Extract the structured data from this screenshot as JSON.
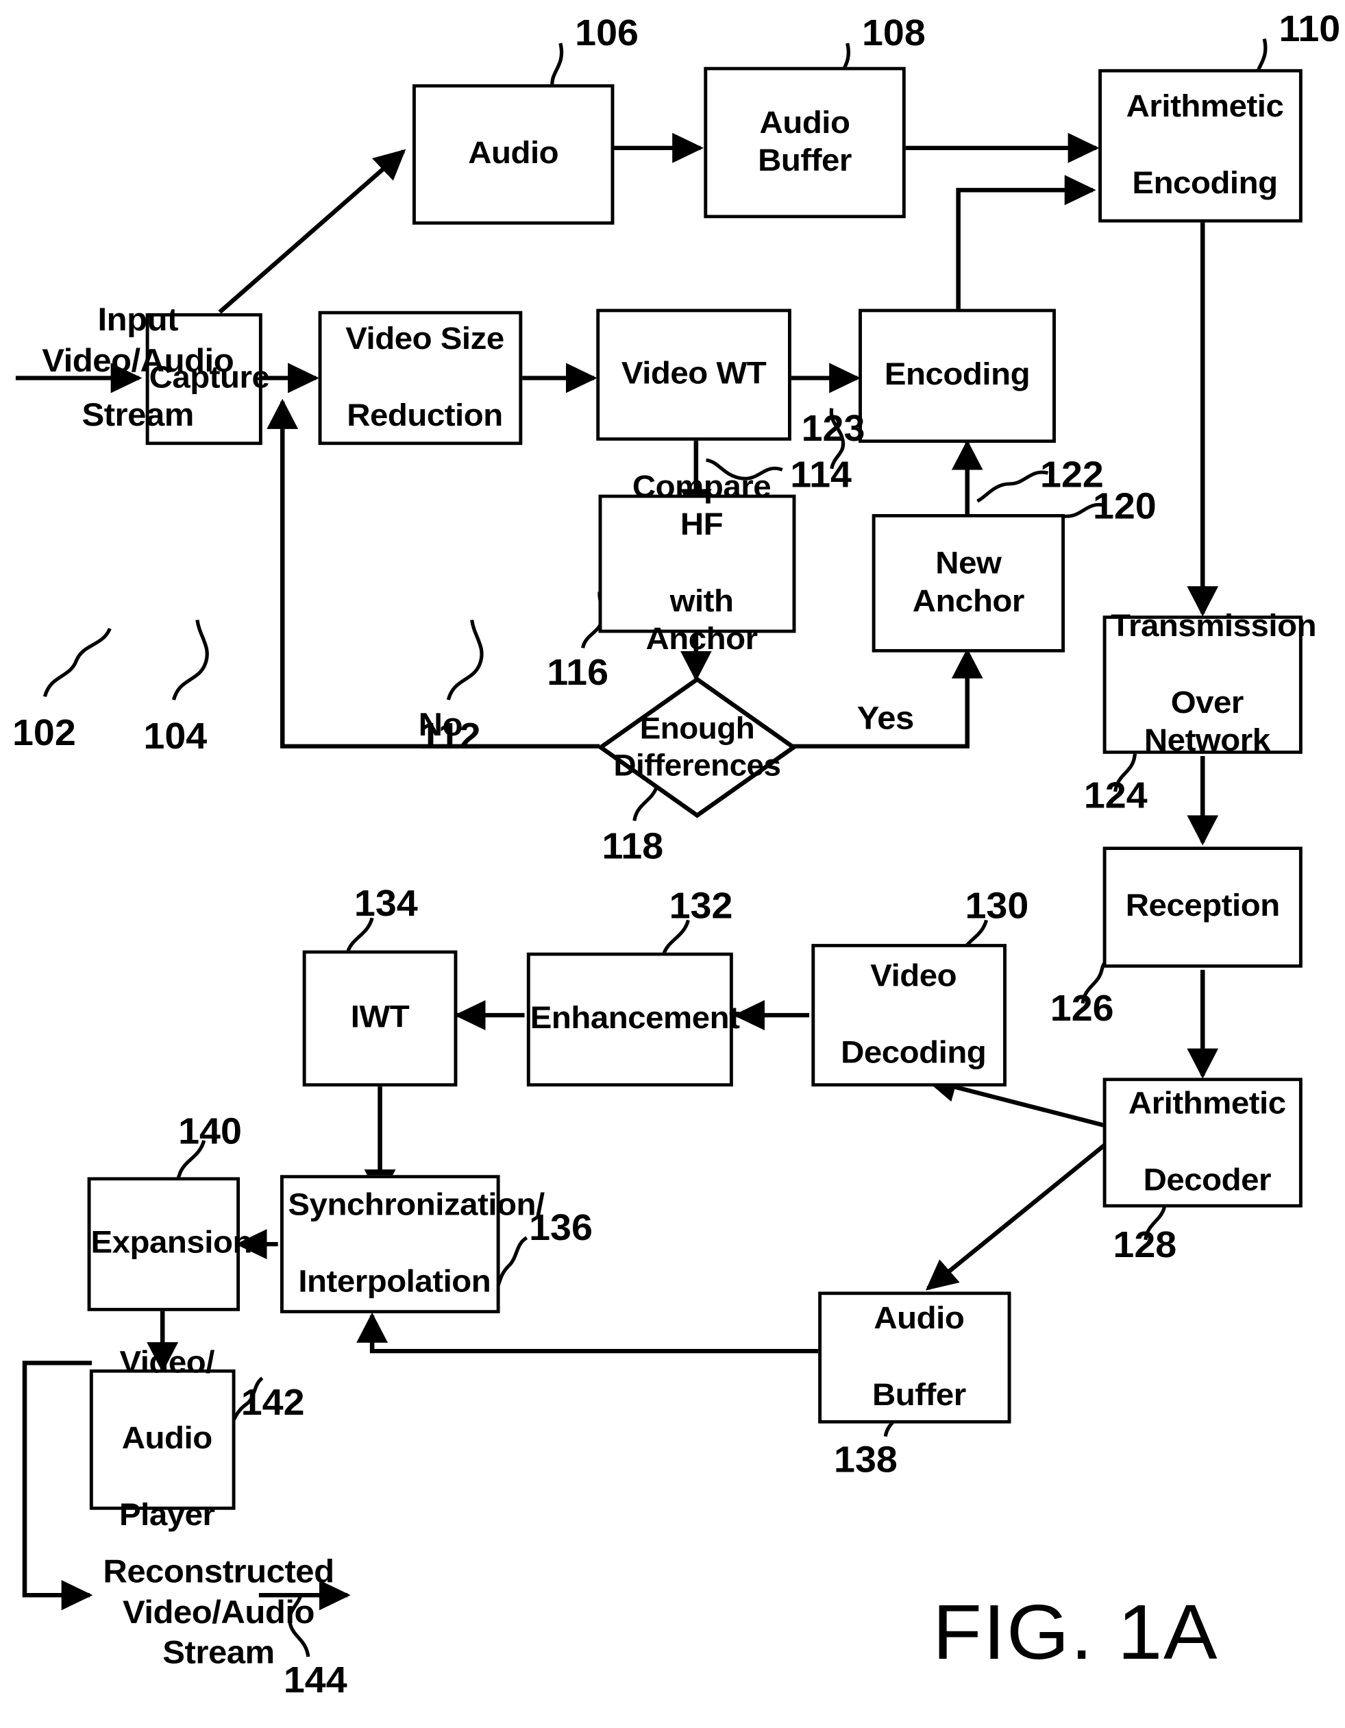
{
  "figure": {
    "label": "FIG. 1A",
    "type": "patent-block-diagram"
  },
  "io_labels": {
    "input_stream": "Input\nVideo/Audio\nStream",
    "input_stream_line1": "Input",
    "input_stream_line2": "Video/Audio",
    "input_stream_line3": "Stream",
    "output_stream_line1": "Reconstructed",
    "output_stream_line2": "Video/Audio",
    "output_stream_line3": "Stream"
  },
  "decision_labels": {
    "no": "No",
    "yes": "Yes"
  },
  "blocks": [
    {
      "id": "audio",
      "label": "Audio",
      "ref": "106"
    },
    {
      "id": "audio_buffer",
      "label": "Audio Buffer",
      "ref": "108"
    },
    {
      "id": "arith_enc",
      "label": "Arithmetic\nEncoding",
      "ref": "110"
    },
    {
      "id": "capture",
      "label": "Capture",
      "ref": "104"
    },
    {
      "id": "vsr",
      "label": "Video Size\nReduction",
      "ref": "112"
    },
    {
      "id": "video_wt",
      "label": "Video WT",
      "ref": ""
    },
    {
      "id": "encoding",
      "label": "Encoding",
      "ref": ""
    },
    {
      "id": "compare_hf",
      "label": "Compare HF\nwith Anchor",
      "ref": "116"
    },
    {
      "id": "new_anchor",
      "label": "New Anchor",
      "ref": "120"
    },
    {
      "id": "transmission",
      "label": "Transmission\nOver Network",
      "ref": "124"
    },
    {
      "id": "reception",
      "label": "Reception",
      "ref": "126"
    },
    {
      "id": "arith_dec",
      "label": "Arithmetic\nDecoder",
      "ref": "128"
    },
    {
      "id": "video_dec",
      "label": "Video\nDecoding",
      "ref": "130"
    },
    {
      "id": "enhancement",
      "label": "Enhancement",
      "ref": "132"
    },
    {
      "id": "iwt",
      "label": "IWT",
      "ref": "134"
    },
    {
      "id": "sync_interp",
      "label": "Synchronization/\nInterpolation",
      "ref": "136"
    },
    {
      "id": "expansion",
      "label": "Expansion",
      "ref": "140"
    },
    {
      "id": "audio_buf2",
      "label": "Audio\nBuffer",
      "ref": "138"
    },
    {
      "id": "player",
      "label": "Video/\nAudio\nPlayer",
      "ref": "142"
    }
  ],
  "block_text": {
    "audio": "Audio",
    "audio_buffer": "Audio Buffer",
    "arith_enc_l1": "Arithmetic",
    "arith_enc_l2": "Encoding",
    "capture": "Capture",
    "vsr_l1": "Video Size",
    "vsr_l2": "Reduction",
    "video_wt": "Video WT",
    "encoding": "Encoding",
    "compare_l1": "Compare HF",
    "compare_l2": "with Anchor",
    "new_anchor": "New Anchor",
    "diamond_l1": "Enough",
    "diamond_l2": "Differences",
    "transmission_l1": "Transmission",
    "transmission_l2": "Over Network",
    "reception": "Reception",
    "arith_dec_l1": "Arithmetic",
    "arith_dec_l2": "Decoder",
    "video_dec_l1": "Video",
    "video_dec_l2": "Decoding",
    "enhancement": "Enhancement",
    "iwt": "IWT",
    "sync_l1": "Synchronization/",
    "sync_l2": "Interpolation",
    "expansion": "Expansion",
    "audio_buf2_l1": "Audio",
    "audio_buf2_l2": "Buffer",
    "player_l1": "Video/",
    "player_l2": "Audio",
    "player_l3": "Player"
  },
  "ref_numerals": {
    "n102": "102",
    "n104": "104",
    "n106": "106",
    "n108": "108",
    "n110": "110",
    "n112": "112",
    "n114": "114",
    "n116": "116",
    "n118": "118",
    "n120": "120",
    "n122": "122",
    "n123": "123",
    "n124": "124",
    "n126": "126",
    "n128": "128",
    "n130": "130",
    "n132": "132",
    "n134": "134",
    "n136": "136",
    "n138": "138",
    "n140": "140",
    "n142": "142",
    "n144": "144"
  },
  "colors": {
    "stroke": "#000000",
    "background": "#ffffff"
  }
}
